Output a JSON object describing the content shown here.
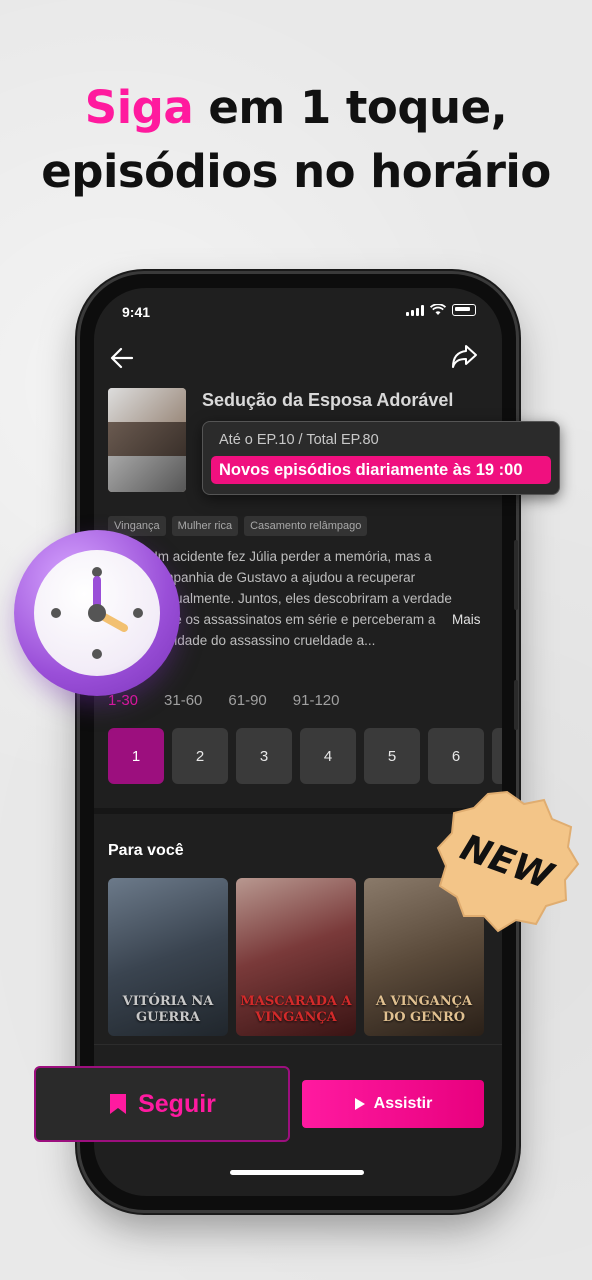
{
  "headline": {
    "highlight": "Siga",
    "line1_rest": " em 1 toque,",
    "line2": "episódios no horário"
  },
  "status_bar": {
    "time": "9:41"
  },
  "show": {
    "title": "Sedução da Esposa Adorável",
    "episode_progress": "Até o EP.10  / Total EP.80",
    "new_episodes": "Novos episódios diariamente às 19 :00",
    "tags": [
      "Vingança",
      "Mulher rica",
      "Casamento relâmpago"
    ],
    "synopsis": "Um acidente fez Júlia perder a memória, mas a companhia de Gustavo a ajudou a recuperar gradualmente. Juntos, eles descobriram a verdade sobre os assassinatos em série e perceberam a crueldade do assassino crueldade a...",
    "more_label": "Mais"
  },
  "episode_ranges": [
    "1-30",
    "31-60",
    "61-90",
    "91-120"
  ],
  "episodes": [
    "1",
    "2",
    "3",
    "4",
    "5",
    "6"
  ],
  "for_you": {
    "title": "Para você",
    "cards": [
      {
        "title": "VITÓRIA NA GUERRA"
      },
      {
        "title": "MASCARADA A VINGANÇA"
      },
      {
        "title": "A VINGANÇA DO GENRO"
      }
    ]
  },
  "badge": {
    "text": "NEW"
  },
  "actions": {
    "follow_label": "Seguir",
    "watch_label": "Assistir"
  },
  "colors": {
    "accent": "#ff1a9e",
    "selected_episode": "#9c0f7e",
    "clock": "#9a4fd8",
    "badge": "#f0c080"
  },
  "icons": [
    "back-arrow-icon",
    "share-icon",
    "bookmark-icon",
    "play-icon",
    "clock-icon",
    "wifi-icon",
    "battery-icon",
    "signal-icon"
  ]
}
